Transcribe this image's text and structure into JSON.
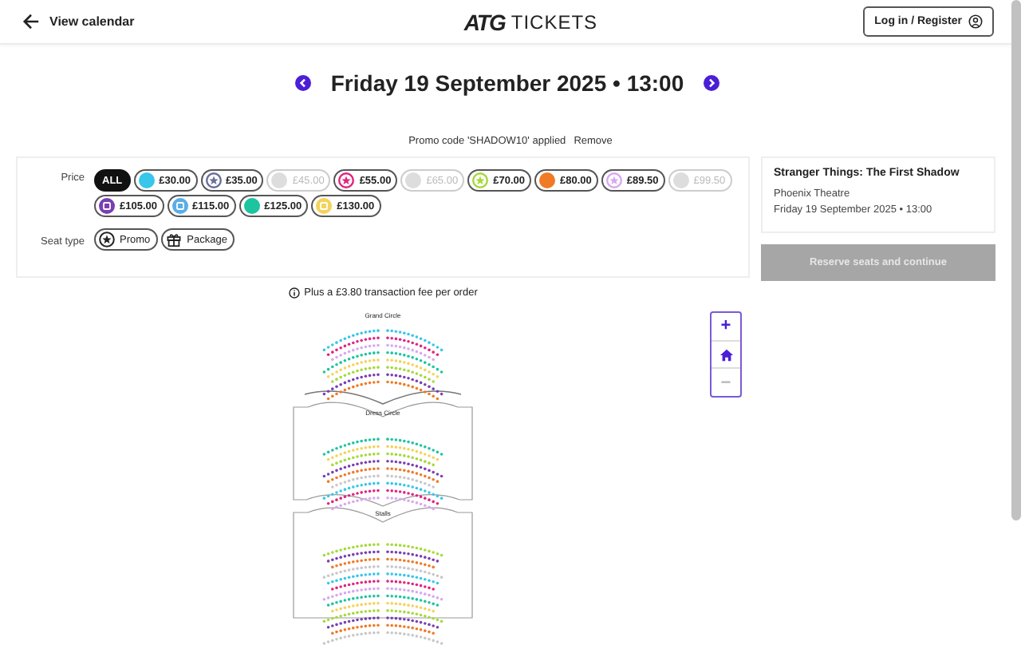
{
  "header": {
    "back_link": "View calendar",
    "logo_mark": "ATG",
    "logo_text": "TICKETS",
    "login_button": "Log in / Register"
  },
  "performance": {
    "date_title": "Friday 19 September 2025 • 13:00"
  },
  "promo": {
    "message": "Promo code 'SHADOW10' applied",
    "remove_link": "Remove"
  },
  "filters": {
    "price_label": "Price",
    "prices": [
      {
        "label": "ALL",
        "kind": "all",
        "selected": true
      },
      {
        "label": "£30.00",
        "kind": "dot",
        "color": "#38c6ea",
        "available": true,
        "selected": false
      },
      {
        "label": "£35.00",
        "kind": "star",
        "color": "#6a6f9a",
        "available": true,
        "selected": false
      },
      {
        "label": "£45.00",
        "kind": "dot",
        "color": "#dddddd",
        "available": false,
        "selected": false
      },
      {
        "label": "£55.00",
        "kind": "star",
        "color": "#e0267f",
        "available": true,
        "selected": false
      },
      {
        "label": "£65.00",
        "kind": "dot",
        "color": "#dddddd",
        "available": false,
        "selected": false
      },
      {
        "label": "£70.00",
        "kind": "star",
        "color": "#a6d93a",
        "available": true,
        "selected": false
      },
      {
        "label": "£80.00",
        "kind": "dot",
        "color": "#f07a25",
        "available": true,
        "selected": false
      },
      {
        "label": "£89.50",
        "kind": "star",
        "color": "#d9a8f0",
        "available": true,
        "selected": false
      },
      {
        "label": "£99.50",
        "kind": "dot",
        "color": "#dddddd",
        "available": false,
        "selected": false
      },
      {
        "label": "£105.00",
        "kind": "seat",
        "color": "#7a3fb0",
        "available": true,
        "selected": false
      },
      {
        "label": "£115.00",
        "kind": "seat",
        "color": "#5aaee6",
        "available": true,
        "selected": false
      },
      {
        "label": "£125.00",
        "kind": "dot",
        "color": "#1cc4a0",
        "available": true,
        "selected": false
      },
      {
        "label": "£130.00",
        "kind": "seat",
        "color": "#f4d35a",
        "available": true,
        "selected": false
      }
    ],
    "seat_type_label": "Seat type",
    "seat_types": [
      {
        "label": "Promo",
        "kind": "promo",
        "selected": false
      },
      {
        "label": "Package",
        "kind": "package",
        "selected": false
      }
    ]
  },
  "summary": {
    "show_title": "Stranger Things: The First Shadow",
    "venue": "Phoenix Theatre",
    "date": "Friday 19 September 2025 • 13:00",
    "reserve_button": "Reserve seats and continue",
    "reserve_disabled": true
  },
  "fee_note": "Plus a £3.80 transaction fee per order",
  "seat_map": {
    "sections": [
      "Grand Circle",
      "Dress Circle",
      "Stalls"
    ]
  },
  "zoom_controls": {
    "zoom_in": "+",
    "zoom_out": "−"
  }
}
